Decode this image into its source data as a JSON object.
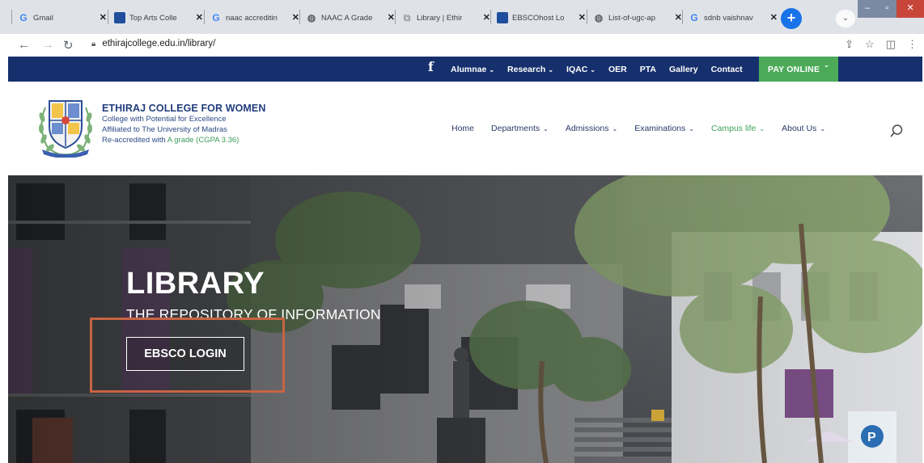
{
  "browser": {
    "tabs": [
      {
        "label": "Gmail",
        "favicon": "google-g",
        "color": "#4285f4"
      },
      {
        "label": "Top Arts Colle",
        "favicon": "blue-square",
        "color": "#1f4e9c"
      },
      {
        "label": "naac accreditin",
        "favicon": "google-g",
        "color": "#4285f4"
      },
      {
        "label": "NAAC A Grade",
        "favicon": "globe",
        "color": "#5f6368"
      },
      {
        "label": "Library | Ethir",
        "favicon": "bookmark",
        "color": "#9aa0a6"
      },
      {
        "label": "EBSCOhost Lo",
        "favicon": "blue-square",
        "color": "#1f4e9c"
      },
      {
        "label": "List-of-ugc-ap",
        "favicon": "globe",
        "color": "#5f6368"
      },
      {
        "label": "sdnb vaishnav",
        "favicon": "google-g",
        "color": "#4285f4"
      }
    ],
    "url": "ethirajcollege.edu.in/library/"
  },
  "topbar": {
    "facebook_glyph": "f",
    "items": [
      {
        "label": "Alumnae",
        "caret": "⌄"
      },
      {
        "label": "Research",
        "caret": "⌄"
      },
      {
        "label": "IQAC",
        "caret": "⌄"
      },
      {
        "label": "OER",
        "caret": ""
      },
      {
        "label": "PTA",
        "caret": ""
      },
      {
        "label": "Gallery",
        "caret": ""
      },
      {
        "label": "Contact",
        "caret": ""
      }
    ],
    "pay_online": "PAY ONLINE",
    "pay_online_caret": "⌄"
  },
  "header": {
    "college_name": "ETHIRAJ COLLEGE FOR WOMEN",
    "line1": "College with Potential for Excellence",
    "line2": "Affiliated to The University of Madras",
    "line3_prefix": "Re-accredited with ",
    "line3_grade": "A grade (CGPA 3.36)"
  },
  "mainnav": [
    {
      "label": "Home",
      "caret": "",
      "active": false
    },
    {
      "label": "Departments",
      "caret": "⌄",
      "active": false
    },
    {
      "label": "Admissions",
      "caret": "⌄",
      "active": false
    },
    {
      "label": "Examinations",
      "caret": "⌄",
      "active": false
    },
    {
      "label": "Campus life",
      "caret": "⌄",
      "active": true
    },
    {
      "label": "About Us",
      "caret": "⌄",
      "active": false
    }
  ],
  "hero": {
    "title": "LIBRARY",
    "subtitle": "THE REPOSITORY OF INFORMATION",
    "button": "EBSCO LOGIN"
  },
  "colors": {
    "navy": "#16306d",
    "green": "#4caa59",
    "highlight": "#c86443"
  }
}
